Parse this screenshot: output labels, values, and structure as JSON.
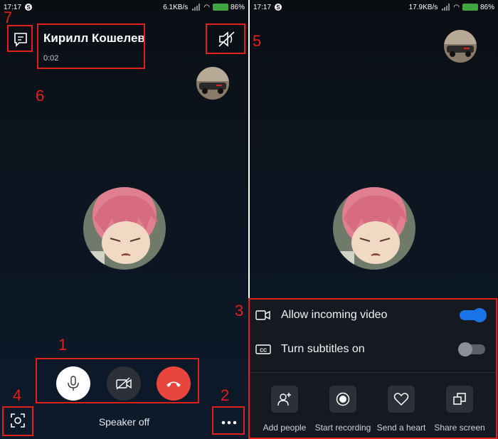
{
  "status_left": {
    "time": "17:17",
    "speed": "6.1KB/s",
    "battery": "86%"
  },
  "status_right": {
    "time": "17:17",
    "speed": "17.9KB/s",
    "battery": "86%"
  },
  "call": {
    "contact_name": "Кирилл Кошелев",
    "duration": "0:02"
  },
  "controls": {
    "speaker_text": "Speaker off"
  },
  "panel": {
    "rows": [
      {
        "label": "Allow incoming video",
        "on": true
      },
      {
        "label": "Turn subtitles on",
        "on": false
      }
    ],
    "actions": [
      {
        "label": "Add people",
        "icon": "add-person-icon"
      },
      {
        "label": "Start recording",
        "icon": "record-icon"
      },
      {
        "label": "Send a heart",
        "icon": "heart-icon"
      },
      {
        "label": "Share screen",
        "icon": "share-screen-icon"
      }
    ]
  },
  "annotations": {
    "n1": "1",
    "n2": "2",
    "n3": "3",
    "n4": "4",
    "n5": "5",
    "n6": "6",
    "n7": "7"
  },
  "colors": {
    "accent": "#1a73e8",
    "end_call": "#e8453c",
    "annotation": "#e0201a"
  }
}
